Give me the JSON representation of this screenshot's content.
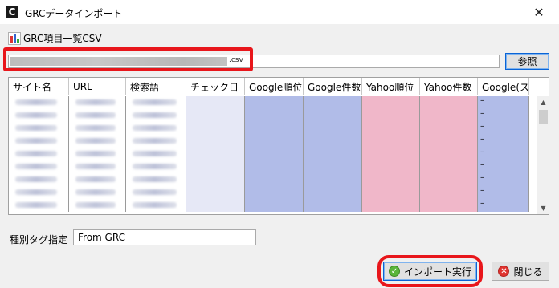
{
  "window": {
    "title": "GRCデータインポート",
    "app_icon_glyph": "C",
    "close_glyph": "✕"
  },
  "file_section": {
    "label": "GRC項目一覧CSV",
    "path_suffix": ".csv",
    "browse_label": "参照"
  },
  "grid": {
    "columns": [
      "サイト名",
      "URL",
      "検索語",
      "チェック日",
      "Google順位",
      "Google件数",
      "Yahoo順位",
      "Yahoo件数",
      "Google(ス..."
    ],
    "last_column_value": "–",
    "visible_row_count": 9
  },
  "tag": {
    "label": "種別タグ指定",
    "value": "From GRC"
  },
  "buttons": {
    "import_label": "インポート実行",
    "close_label": "閉じる"
  },
  "icons": {
    "app": "grc-app-icon",
    "csv": "csv-chart-icon",
    "ok": "check-circle-icon",
    "cancel": "cancel-circle-icon",
    "close": "close-icon"
  },
  "colors": {
    "highlight_red": "#e8161b",
    "google_col": "#b1bce8",
    "yahoo_col": "#f0b7c9",
    "checkdate_col": "#e6e8f6"
  }
}
